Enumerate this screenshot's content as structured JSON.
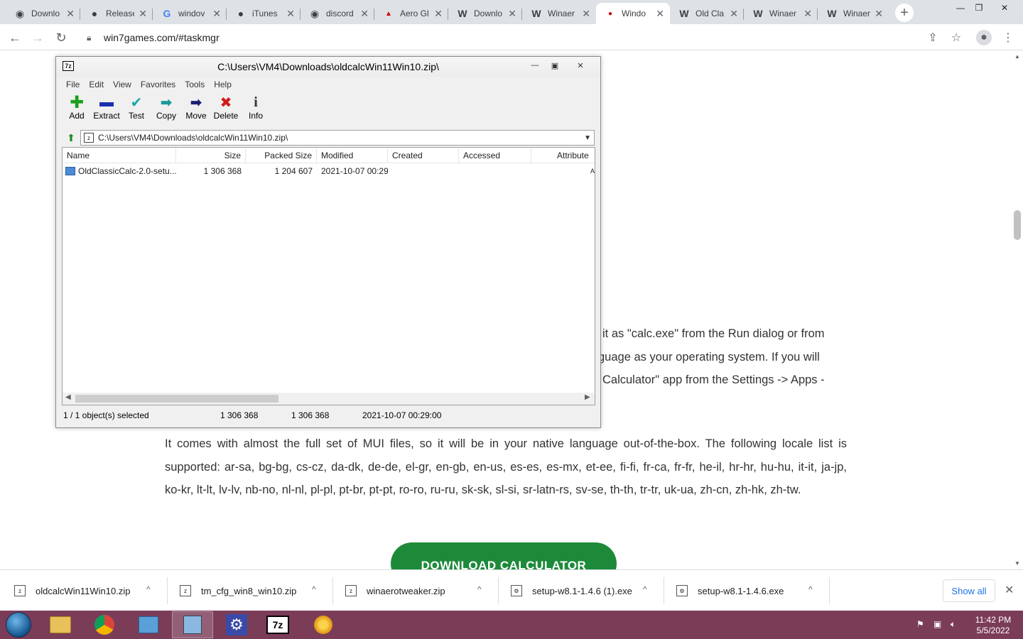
{
  "browser": {
    "tabs": [
      {
        "title": "Downlo",
        "icon": "globe-icon"
      },
      {
        "title": "Release",
        "icon": "github-icon"
      },
      {
        "title": "windov",
        "icon": "google-icon"
      },
      {
        "title": "iTunes",
        "icon": "apple-icon"
      },
      {
        "title": "discord",
        "icon": "globe-icon"
      },
      {
        "title": "Aero Gl",
        "icon": "site-icon"
      },
      {
        "title": "Downlo",
        "icon": "winaero-w-icon"
      },
      {
        "title": "Winaer",
        "icon": "winaero-w-icon"
      },
      {
        "title": "Windo",
        "icon": "site-icon"
      },
      {
        "title": "Old Cla",
        "icon": "winaero-w-icon"
      },
      {
        "title": "Winaer",
        "icon": "winaero-w-icon"
      },
      {
        "title": "Winaer",
        "icon": "winaero-w-icon"
      }
    ],
    "active_tab_index": 8,
    "url": "win7games.com/#taskmgr"
  },
  "page": {
    "para1_lines": [
      "it as \"calc.exe\" from the Run dialog or from",
      "guage as your operating system. If you will",
      "Calculator\" app from the Settings -> Apps -"
    ],
    "para2": "It comes with almost the full set of MUI files, so it will be in your native language out-of-the-box. The following locale list is supported: ar-sa, bg-bg, cs-cz, da-dk, de-de, el-gr, en-gb, en-us, es-es, es-mx, et-ee, fi-fi, fr-ca, fr-fr, he-il, hr-hr, hu-hu, it-it, ja-jp, ko-kr, lt-lt, lv-lv, nb-no, nl-nl, pl-pl, pt-br, pt-pt, ro-ro, ru-ru, sk-sk, sl-si, sr-latn-rs, sv-se, th-th, tr-tr, uk-ua, zh-cn, zh-hk, zh-tw.",
    "download_button": "DOWNLOAD CALCULATOR"
  },
  "sevenzip": {
    "title": "C:\\Users\\VM4\\Downloads\\oldcalcWin11Win10.zip\\",
    "logo": "7z",
    "menu": [
      "File",
      "Edit",
      "View",
      "Favorites",
      "Tools",
      "Help"
    ],
    "tools": [
      {
        "label": "Add",
        "icon": "add-icon",
        "color": "#1e9e1e"
      },
      {
        "label": "Extract",
        "icon": "extract-icon",
        "color": "#1a2fb0"
      },
      {
        "label": "Test",
        "icon": "test-icon",
        "color": "#1aa8a8"
      },
      {
        "label": "Copy",
        "icon": "copy-icon",
        "color": "#1a9a9a"
      },
      {
        "label": "Move",
        "icon": "move-icon",
        "color": "#1a2070"
      },
      {
        "label": "Delete",
        "icon": "delete-icon",
        "color": "#d01a1a"
      },
      {
        "label": "Info",
        "icon": "info-icon",
        "color": "#c8a000"
      }
    ],
    "address": "C:\\Users\\VM4\\Downloads\\oldcalcWin11Win10.zip\\",
    "columns": [
      "Name",
      "Size",
      "Packed Size",
      "Modified",
      "Created",
      "Accessed",
      "Attribute"
    ],
    "rows": [
      {
        "name": "OldClassicCalc-2.0-setu...",
        "size": "1 306 368",
        "packed": "1 204 607",
        "modified": "2021-10-07 00:29",
        "created": "",
        "accessed": "",
        "attr": "A"
      }
    ],
    "status": {
      "selected": "1 / 1 object(s) selected",
      "size": "1 306 368",
      "packed": "1 306 368",
      "modified": "2021-10-07 00:29:00"
    }
  },
  "downloads": {
    "items": [
      {
        "name": "oldcalcWin11Win10.zip"
      },
      {
        "name": "tm_cfg_win8_win10.zip"
      },
      {
        "name": "winaerotweaker.zip"
      },
      {
        "name": "setup-w8.1-1.4.6 (1).exe"
      },
      {
        "name": "setup-w8.1-1.4.6.exe"
      }
    ],
    "show_all": "Show all"
  },
  "taskbar": {
    "apps": [
      "explorer-icon",
      "chrome-icon",
      "control-panel-icon",
      "network-setup-icon",
      "settings-gear-icon",
      "7zip-icon",
      "chrome-canary-icon"
    ],
    "active_app_index": 3,
    "time": "11:42 PM",
    "date": "5/5/2022"
  },
  "colors": {
    "taskbar": "#7b3c58",
    "download_button": "#1d8a3a",
    "show_all_link": "#1a73e8"
  }
}
